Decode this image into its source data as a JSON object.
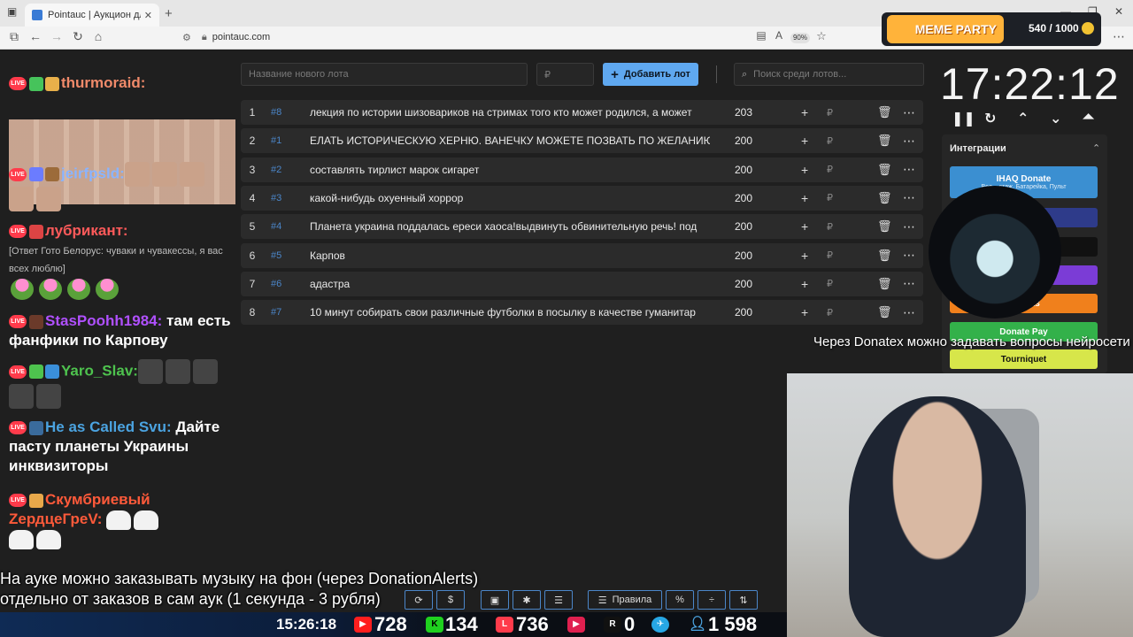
{
  "browser": {
    "tab_title": "Pointauc | Аукцион для стримеров",
    "url": "pointauc.com",
    "zoom": "90%"
  },
  "overlay_top": {
    "brand": "MEME PARTY",
    "counter": "540 / 1000"
  },
  "auction": {
    "new_lot_placeholder": "Название нового лота",
    "amount_placeholder": "₽",
    "add_lot_label": "Добавить лот",
    "search_placeholder": "Поиск среди лотов...",
    "rows": [
      {
        "idx": "1",
        "num": "#8",
        "name": "лекция по истории шизовариков на стримах того кто может родился, а может",
        "amount": "203"
      },
      {
        "idx": "2",
        "num": "#1",
        "name": "ЕЛАТЬ ИСТОРИЧЕСКУЮ ХЕРНЮ. ВАНЕЧКУ МОЖЕТЕ ПОЗВАТЬ ПО ЖЕЛАНИЮ",
        "amount": "200"
      },
      {
        "idx": "3",
        "num": "#2",
        "name": "составлять тирлист марок сигарет",
        "amount": "200"
      },
      {
        "idx": "4",
        "num": "#3",
        "name": "какой-нибудь охуенный хоррор",
        "amount": "200"
      },
      {
        "idx": "5",
        "num": "#4",
        "name": "Планета украина поддалась ереси хаоса!выдвинуть обвинительную речь! под",
        "amount": "200"
      },
      {
        "idx": "6",
        "num": "#5",
        "name": "Карпов",
        "amount": "200"
      },
      {
        "idx": "7",
        "num": "#6",
        "name": "адастра",
        "amount": "200"
      },
      {
        "idx": "8",
        "num": "#7",
        "name": "10 минут собирать свои различные футболки в посылку в качестве гуманитар",
        "amount": "200"
      }
    ]
  },
  "timer": {
    "value": "17:22:12"
  },
  "integrations": {
    "title": "Интеграции",
    "items": [
      {
        "label": "IHAQ Donate",
        "sub": "Вел... стаж, Батарейка, Пульт",
        "color": "#3b8fd1"
      },
      {
        "label": "...er",
        "color": "#2e3b8a"
      },
      {
        "label": "",
        "color": "#111111"
      },
      {
        "label": "",
        "color": "#7b3cd6"
      },
      {
        "label": "...Alerts",
        "color": "#f0801c"
      },
      {
        "label": "Donate Pay",
        "color": "#33b14a"
      },
      {
        "label": "Tourniquet",
        "color": "#d7e64a"
      }
    ]
  },
  "chat": [
    {
      "user": "thurmoraid:",
      "color": "#f08a6a",
      "text": ""
    },
    {
      "user": "jeirfpsld:",
      "color": "#8ab4ff",
      "text": ""
    },
    {
      "user": "лубрикант:",
      "color": "#ff5a5a",
      "reply": "[Ответ Гото Белорус: чуваки и чувакессы, я вас всех люблю]",
      "text": ""
    },
    {
      "user": "StasPoohh1984:",
      "color": "#b050ff",
      "text": "там есть фанфики по Карпову"
    },
    {
      "user": "Yaro_Slav:",
      "color": "#4ec34e",
      "text": ""
    },
    {
      "user": "He as Called Svu:",
      "color": "#4ba3e0",
      "text": "Дайте пасту планеты Украины инквизиторы"
    },
    {
      "user": "Скумбриевый ZердцеГреV:",
      "color": "#ff5a3a",
      "text": ""
    }
  ],
  "donatex_text": "Через Donatex можно задавать вопросы нейросети",
  "notice": {
    "line1": "На ауке можно заказывать музыку на фон (через DonationAlerts)",
    "line2": "отдельно от заказов в сам аук (1 секунда - 3 рубля)"
  },
  "bottom_tools": {
    "rules_label": "Правила",
    "percent_label": "%",
    "dollar_label": "$"
  },
  "stats": {
    "time": "15:26:18",
    "youtube": "728",
    "kick": "134",
    "vk": "736",
    "rutube": "0",
    "total": "1 598"
  },
  "colors": {
    "accent": "#5fa8f0",
    "row_bg": "#2b2b2b",
    "page_bg": "#1f1f1f"
  }
}
